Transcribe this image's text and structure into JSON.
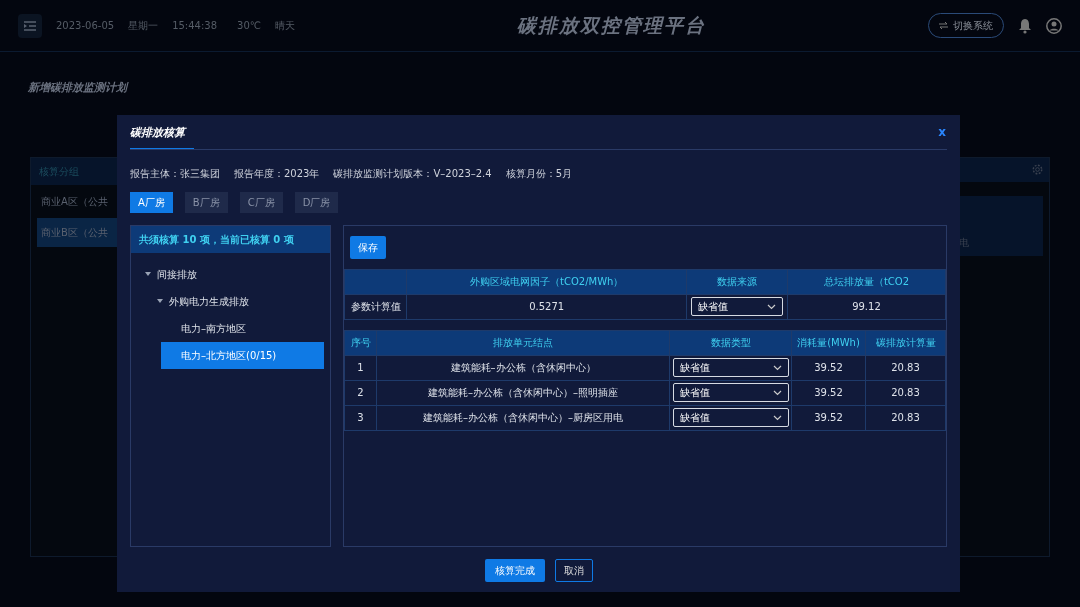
{
  "header": {
    "date": "2023-06-05",
    "weekday": "星期一",
    "time": "15:44:38",
    "temperature": "30℃",
    "weather": "晴天",
    "title": "碳排放双控管理平台",
    "switch_button": "切换系统"
  },
  "page_title": "新增碳排放监测计划",
  "group_panel": {
    "title": "核算分组",
    "items": [
      {
        "label": "商业A区（公共",
        "selected": false
      },
      {
        "label": "商业B区（公共",
        "selected": true
      }
    ]
  },
  "right_panel": {
    "visible_text": "电"
  },
  "dialog": {
    "title": "碳排放核算",
    "close": "x",
    "info": [
      "报告主体：张三集团",
      "报告年度：2023年",
      "碳排放监测计划版本：V–2023–2.4",
      "核算月份：5月"
    ],
    "tabs": [
      {
        "label": "A厂房",
        "selected": true
      },
      {
        "label": "B厂房",
        "selected": false
      },
      {
        "label": "C厂房",
        "selected": false
      },
      {
        "label": "D厂房",
        "selected": false
      }
    ],
    "summary": "共须核算 10 项，当前已核算 0 项",
    "tree": [
      {
        "label": "间接排放",
        "expanded": true,
        "selected": false,
        "children": [
          {
            "label": "外购电力生成排放",
            "expanded": true,
            "selected": false,
            "children": [
              {
                "label": "电力–南方地区",
                "selected": false
              },
              {
                "label": "电力–北方地区(0/15)",
                "selected": true
              }
            ]
          }
        ]
      }
    ],
    "save_button": "保存",
    "param_table": {
      "columns": [
        "外购区域电网因子（tCO2/MWh）",
        "数据来源",
        "总坛排放量（tCO2"
      ],
      "row": {
        "label": "参数计算值",
        "factor": "0.5271",
        "source": "缺省值",
        "total": "99.12"
      }
    },
    "unit_table": {
      "columns": [
        "序号",
        "排放单元结点",
        "数据类型",
        "消耗量(MWh)",
        "碳排放计算量"
      ],
      "rows": [
        {
          "index": "1",
          "node": "建筑能耗–办公栋（含休闲中心）",
          "data_type": "缺省值",
          "consumption": "39.52",
          "emission": "20.83"
        },
        {
          "index": "2",
          "node": "建筑能耗–办公栋（含休闲中心）–照明插座",
          "data_type": "缺省值",
          "consumption": "39.52",
          "emission": "20.83"
        },
        {
          "index": "3",
          "node": "建筑能耗–办公栋（含休闲中心）–厨房区用电",
          "data_type": "缺省值",
          "consumption": "39.52",
          "emission": "20.83"
        }
      ]
    },
    "confirm_button": "核算完成",
    "cancel_button": "取消"
  }
}
